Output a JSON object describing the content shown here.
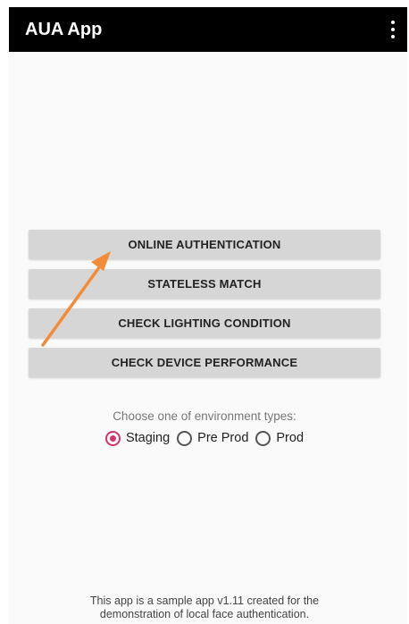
{
  "app_bar": {
    "title": "AUA App",
    "menu_icon": "more-vert-icon"
  },
  "buttons": {
    "online_authentication": "ONLINE AUTHENTICATION",
    "stateless_match": "STATELESS MATCH",
    "check_lighting_condition": "CHECK LIGHTING CONDITION",
    "check_device_performance": "CHECK DEVICE PERFORMANCE"
  },
  "environment": {
    "prompt": "Choose one of environment types:",
    "options": [
      {
        "label": "Staging",
        "selected": true
      },
      {
        "label": "Pre Prod",
        "selected": false
      },
      {
        "label": "Prod",
        "selected": false
      }
    ]
  },
  "footer": {
    "line1": "This app is a sample app v1.11 created for the",
    "line2": "demonstration of local face authentication."
  },
  "colors": {
    "app_bar": "#000000",
    "button_bg": "#d6d6d6",
    "radio_accent": "#d6336c",
    "annotation_arrow": "#f28c38"
  }
}
